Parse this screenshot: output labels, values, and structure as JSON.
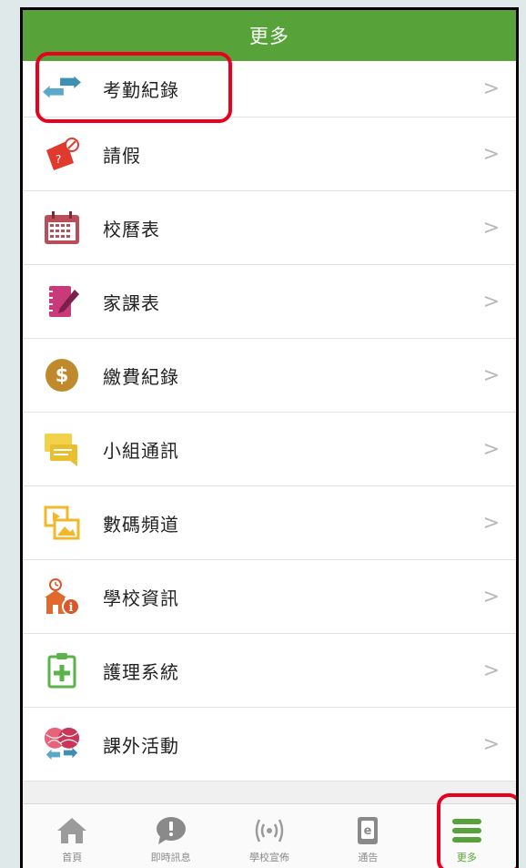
{
  "header": {
    "title": "更多"
  },
  "menu": {
    "items": [
      {
        "label": "考勤紀錄",
        "icon": "attendance-arrows-icon"
      },
      {
        "label": "請假",
        "icon": "leave-ticket-icon"
      },
      {
        "label": "校曆表",
        "icon": "calendar-icon"
      },
      {
        "label": "家課表",
        "icon": "homework-notebook-icon"
      },
      {
        "label": "繳費紀錄",
        "icon": "dollar-coin-icon"
      },
      {
        "label": "小組通訊",
        "icon": "chat-bubbles-icon"
      },
      {
        "label": "數碼頻道",
        "icon": "digital-channel-icon"
      },
      {
        "label": "學校資訊",
        "icon": "school-info-icon"
      },
      {
        "label": "護理系統",
        "icon": "nursing-clipboard-icon"
      },
      {
        "label": "課外活動",
        "icon": "activity-balls-icon"
      }
    ],
    "chevron": ">"
  },
  "tabbar": {
    "tabs": [
      {
        "label": "首頁",
        "icon": "home-icon"
      },
      {
        "label": "即時訊息",
        "icon": "instant-message-icon"
      },
      {
        "label": "學校宣佈",
        "icon": "broadcast-icon"
      },
      {
        "label": "通告",
        "icon": "notice-icon"
      },
      {
        "label": "更多",
        "icon": "more-menu-icon"
      }
    ]
  },
  "colors": {
    "brand_green": "#57a33a",
    "highlight_red": "#e8001c"
  }
}
